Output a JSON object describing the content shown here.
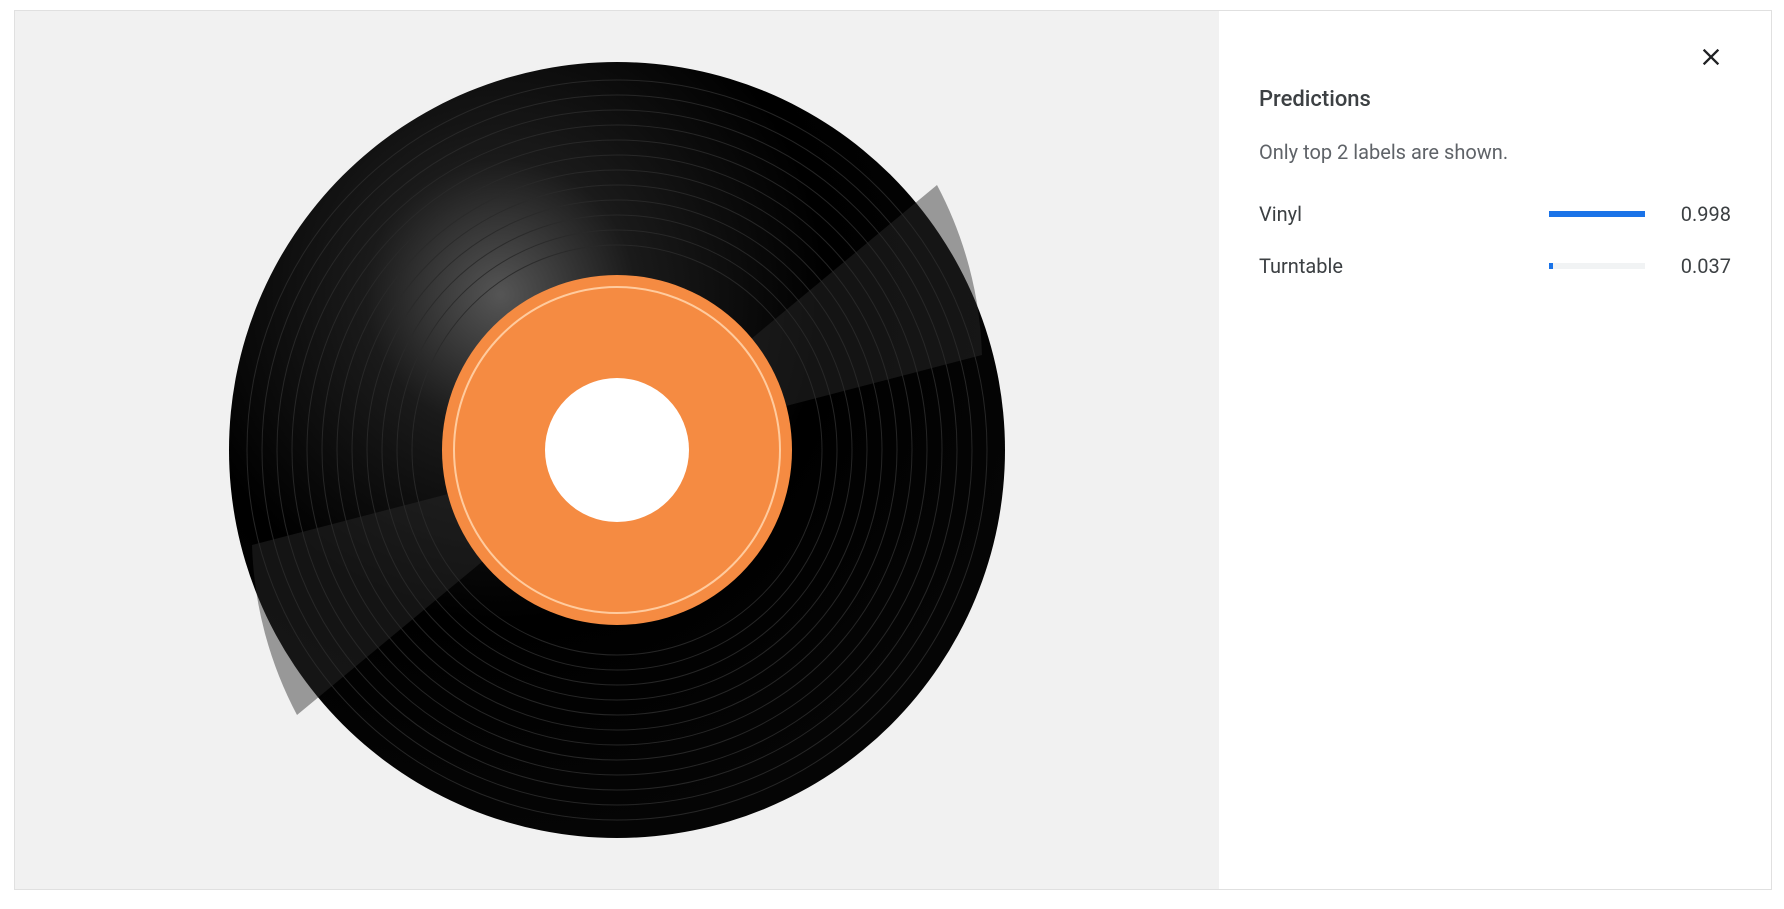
{
  "panel": {
    "title": "Predictions",
    "subtitle": "Only top 2 labels are shown."
  },
  "predictions": [
    {
      "label": "Vinyl",
      "score": 0.998,
      "score_text": "0.998"
    },
    {
      "label": "Turntable",
      "score": 0.037,
      "score_text": "0.037"
    }
  ],
  "colors": {
    "accent": "#1a73e8",
    "vinyl_label": "#f58b42",
    "vinyl_black": "#0e0e0e"
  },
  "image": {
    "subject": "vinyl-record"
  }
}
